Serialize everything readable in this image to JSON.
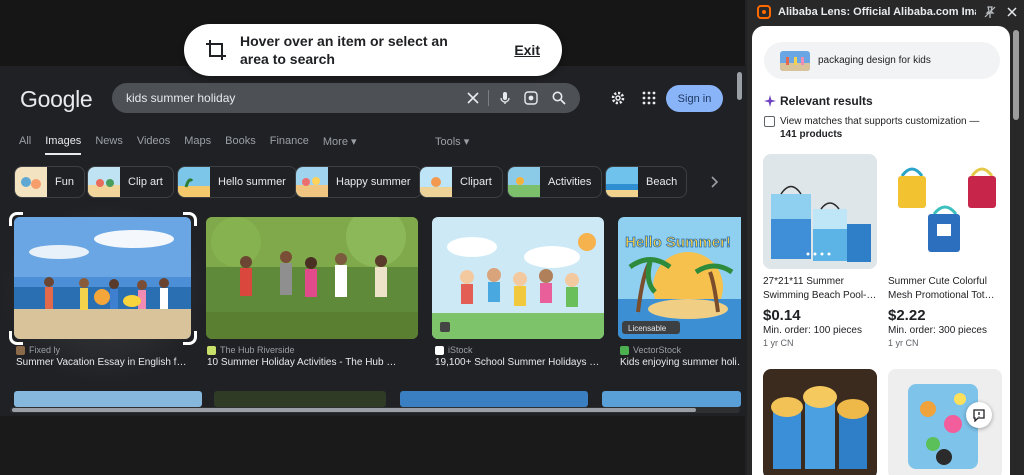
{
  "banner": {
    "message_line1": "Hover over an item or select an",
    "message_line2": "area to search",
    "exit_label": "Exit"
  },
  "google": {
    "logo": "Google",
    "query": "kids summer holiday",
    "signin_label": "Sign in",
    "tabs": [
      "All",
      "Images",
      "News",
      "Videos",
      "Maps",
      "Books",
      "Finance",
      "More ▾"
    ],
    "active_tab": "Images",
    "tools_label": "Tools ▾",
    "chips": [
      "Fun",
      "Clip art",
      "Hello summer",
      "Happy summer",
      "Clipart",
      "Activities",
      "Beach"
    ],
    "results": [
      {
        "source": "Fixed ly",
        "title": "Summer Vacation Essay in English f…"
      },
      {
        "source": "The Hub Riverside",
        "title": "10 Summer Holiday Activities - The Hub …"
      },
      {
        "source": "iStock",
        "title": "19,100+ School Summer Holidays …"
      },
      {
        "source": "VectorStock",
        "title": "Kids enjoying summer holi…",
        "badge": "Licensable",
        "image_text": "Hello Summer!"
      }
    ],
    "icons": [
      "clear-icon",
      "microphone-icon",
      "lens-icon",
      "search-icon",
      "settings-icon",
      "apps-icon",
      "crop-icon"
    ]
  },
  "panel": {
    "title": "Alibaba Lens: Official Alibaba.com Imag…",
    "query": "packaging design for kids",
    "relevant_label": "Relevant results",
    "matches_text": "View matches that supports customization —",
    "matches_count": "141 products",
    "products": [
      {
        "name1": "27*21*11 Summer",
        "name2": "Swimming Beach Pool-…",
        "price": "$0.14",
        "moq": "Min. order: 100 pieces",
        "meta": "1 yr  CN"
      },
      {
        "name1": "Summer Cute Colorful",
        "name2": "Mesh Promotional Tot…",
        "price": "$2.22",
        "moq": "Min. order: 300 pieces",
        "meta": "1 yr  CN"
      }
    ]
  },
  "colors": {
    "accent": "#8ab4f8",
    "sparkle": "#6f42c1",
    "alibaba": "#ff6a00"
  }
}
